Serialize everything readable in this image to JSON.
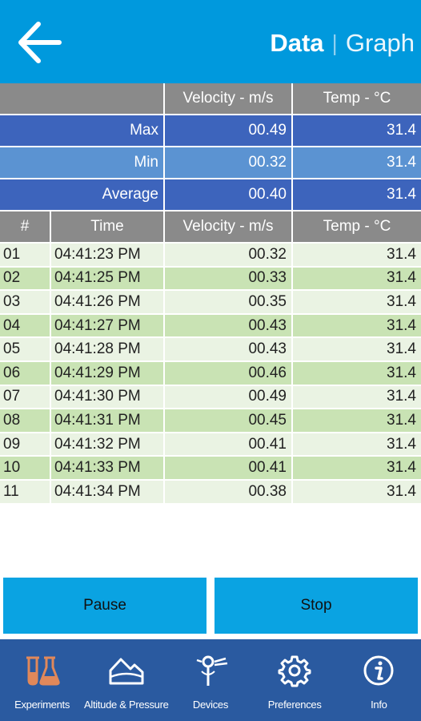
{
  "header": {
    "tab_data": "Data",
    "tab_separator": "|",
    "tab_graph": "Graph"
  },
  "summary": {
    "columns": [
      "",
      "Velocity - m/s",
      "Temp - °C"
    ],
    "rows": [
      {
        "label": "Max",
        "velocity": "00.49",
        "temp": "31.4"
      },
      {
        "label": "Min",
        "velocity": "00.32",
        "temp": "31.4"
      },
      {
        "label": "Average",
        "velocity": "00.40",
        "temp": "31.4"
      }
    ]
  },
  "data_table": {
    "columns": [
      "#",
      "Time",
      "Velocity - m/s",
      "Temp - °C"
    ],
    "rows": [
      {
        "n": "01",
        "time": "04:41:23 PM",
        "velocity": "00.32",
        "temp": "31.4"
      },
      {
        "n": "02",
        "time": "04:41:25 PM",
        "velocity": "00.33",
        "temp": "31.4"
      },
      {
        "n": "03",
        "time": "04:41:26 PM",
        "velocity": "00.35",
        "temp": "31.4"
      },
      {
        "n": "04",
        "time": "04:41:27 PM",
        "velocity": "00.43",
        "temp": "31.4"
      },
      {
        "n": "05",
        "time": "04:41:28 PM",
        "velocity": "00.43",
        "temp": "31.4"
      },
      {
        "n": "06",
        "time": "04:41:29 PM",
        "velocity": "00.46",
        "temp": "31.4"
      },
      {
        "n": "07",
        "time": "04:41:30 PM",
        "velocity": "00.49",
        "temp": "31.4"
      },
      {
        "n": "08",
        "time": "04:41:31 PM",
        "velocity": "00.45",
        "temp": "31.4"
      },
      {
        "n": "09",
        "time": "04:41:32 PM",
        "velocity": "00.41",
        "temp": "31.4"
      },
      {
        "n": "10",
        "time": "04:41:33 PM",
        "velocity": "00.41",
        "temp": "31.4"
      },
      {
        "n": "11",
        "time": "04:41:34 PM",
        "velocity": "00.38",
        "temp": "31.4"
      }
    ]
  },
  "controls": {
    "pause_label": "Pause",
    "stop_label": "Stop"
  },
  "nav": {
    "items": [
      {
        "label": "Experiments",
        "icon": "flask-icon"
      },
      {
        "label": "Altitude & Pressure",
        "icon": "mountain-icon"
      },
      {
        "label": "Devices",
        "icon": "sensor-device-icon"
      },
      {
        "label": "Preferences",
        "icon": "gear-icon"
      },
      {
        "label": "Info",
        "icon": "info-icon"
      }
    ]
  },
  "colors": {
    "header_bg": "#0099dd",
    "header_row_bg": "#8a8a8a",
    "stat_dark": "#3d64bc",
    "stat_light": "#5b93d2",
    "row_odd": "#eaf3e3",
    "row_even": "#c9e3b4",
    "button_bg": "#0aa3e2",
    "nav_bg": "#2a5aa0",
    "active_icon": "#e0885a"
  }
}
